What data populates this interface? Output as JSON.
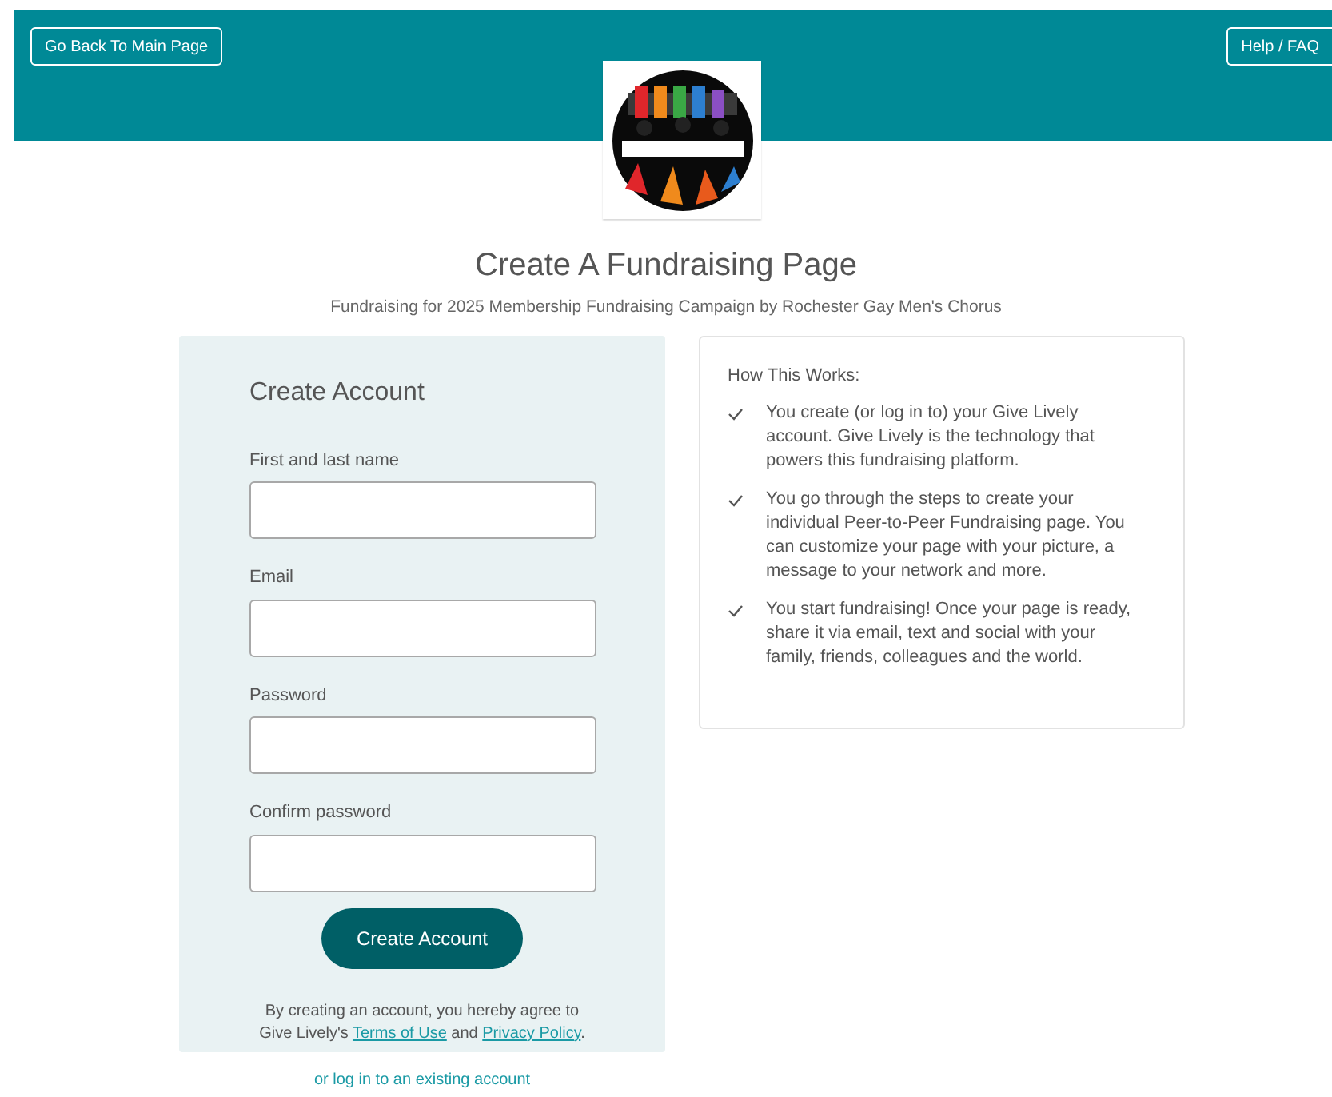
{
  "header": {
    "back_button": "Go Back To Main Page",
    "help_button": "Help / FAQ"
  },
  "title": "Create A Fundraising Page",
  "subtitle": "Fundraising for 2025 Membership Fundraising Campaign by Rochester Gay Men's Chorus",
  "form": {
    "heading": "Create Account",
    "fields": [
      {
        "label": "First and last name"
      },
      {
        "label": "Email"
      },
      {
        "label": "Password"
      },
      {
        "label": "Confirm password"
      }
    ],
    "submit": "Create Account",
    "agreement": {
      "before": "By creating an account, you hereby agree to Give Lively's",
      "terms_link": "Terms of Use",
      "middle": "and",
      "privacy_link": "Privacy Policy",
      "after": "."
    }
  },
  "login_link": "or log in to an existing account",
  "how_it_works": {
    "heading": "How This Works:",
    "steps": [
      "You create (or log in to) your Give Lively account. Give Lively is the technology that powers this fundraising platform.",
      "You go through the steps to create your individual Peer-to-Peer Fundraising page. You can customize your page with your picture, a message to your network and more.",
      "You start fundraising! Once your page is ready, share it via email, text and social with your family, friends, colleagues and the world."
    ]
  }
}
